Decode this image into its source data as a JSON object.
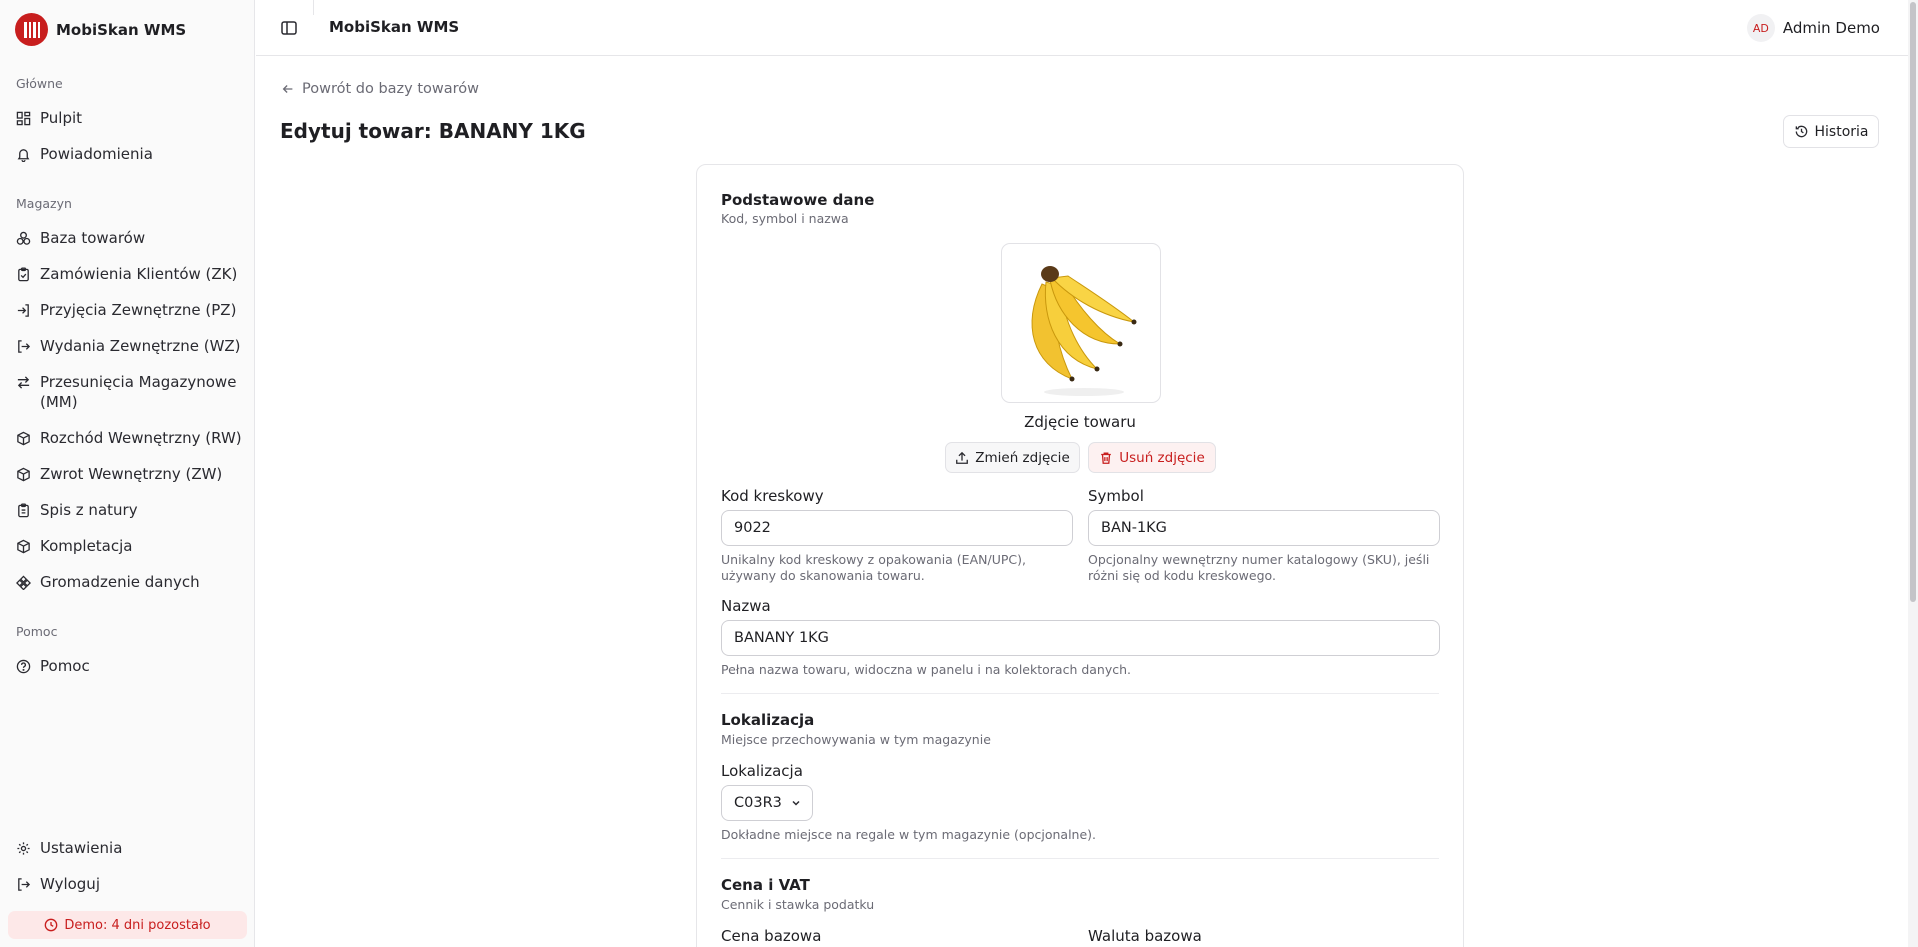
{
  "app": {
    "name": "MobiSkan WMS"
  },
  "sidebar": {
    "groups": [
      {
        "label": "Główne"
      },
      {
        "label": "Magazyn"
      },
      {
        "label": "Pomoc"
      }
    ],
    "items": [
      {
        "label": "Pulpit",
        "icon": "grid-icon"
      },
      {
        "label": "Powiadomienia",
        "icon": "bell-icon"
      },
      {
        "label": "Baza towarów",
        "icon": "boxes-icon"
      },
      {
        "label": "Zamówienia Klientów (ZK)",
        "icon": "clipboard-check-icon"
      },
      {
        "label": "Przyjęcia Zewnętrzne (PZ)",
        "icon": "log-in-icon"
      },
      {
        "label": "Wydania Zewnętrzne (WZ)",
        "icon": "log-out-icon"
      },
      {
        "label": "Przesunięcia Magazynowe (MM)",
        "icon": "arrows-swap-icon"
      },
      {
        "label": "Rozchód Wewnętrzny (RW)",
        "icon": "package-icon"
      },
      {
        "label": "Zwrot Wewnętrzny (ZW)",
        "icon": "package-icon"
      },
      {
        "label": "Spis z natury",
        "icon": "clipboard-list-icon"
      },
      {
        "label": "Kompletacja",
        "icon": "package-icon"
      },
      {
        "label": "Gromadzenie danych",
        "icon": "network-icon"
      },
      {
        "label": "Pomoc",
        "icon": "help-circle-icon"
      },
      {
        "label": "Ustawienia",
        "icon": "gear-icon"
      },
      {
        "label": "Wyloguj",
        "icon": "log-out-icon"
      }
    ],
    "demo_badge": "Demo: 4 dni pozostało"
  },
  "header": {
    "title": "MobiSkan WMS",
    "user": {
      "initials": "AD",
      "name": "Admin Demo"
    }
  },
  "main": {
    "back_link": "Powrót do bazy towarów",
    "title": "Edytuj towar: BANANY 1KG",
    "history_label": "Historia",
    "basic": {
      "title": "Podstawowe dane",
      "subtitle": "Kod, symbol i nazwa",
      "photo_label": "Zdjęcie towaru",
      "change_photo": "Zmień zdjęcie",
      "delete_photo": "Usuń zdjęcie",
      "barcode_label": "Kod kreskowy",
      "barcode_value": "9022",
      "barcode_hint": "Unikalny kod kreskowy z opakowania (EAN/UPC), używany do skanowania towaru.",
      "symbol_label": "Symbol",
      "symbol_value": "BAN-1KG",
      "symbol_hint": "Opcjonalny wewnętrzny numer katalogowy (SKU), jeśli różni się od kodu kreskowego.",
      "name_label": "Nazwa",
      "name_value": "BANANY 1KG",
      "name_hint": "Pełna nazwa towaru, widoczna w panelu i na kolektorach danych."
    },
    "location": {
      "title": "Lokalizacja",
      "subtitle": "Miejsce przechowywania w tym magazynie",
      "field_label": "Lokalizacja",
      "value": "C03R3",
      "hint": "Dokładne miejsce na regale w tym magazynie (opcjonalne)."
    },
    "price": {
      "title": "Cena i VAT",
      "subtitle": "Cennik i stawka podatku",
      "base_price_label": "Cena bazowa",
      "base_currency_label": "Waluta bazowa"
    }
  },
  "colors": {
    "brand": "#c81e1e",
    "muted": "#6b6b75",
    "border": "#e6e6e9"
  }
}
